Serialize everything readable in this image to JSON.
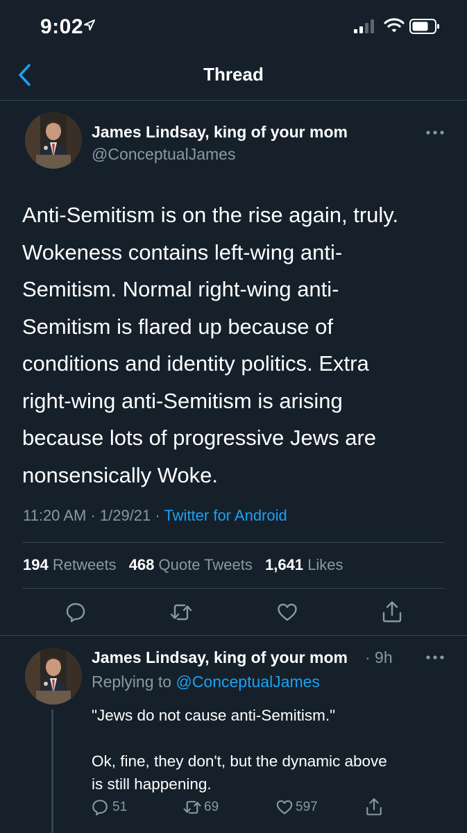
{
  "status_bar": {
    "time": "9:02"
  },
  "nav": {
    "title": "Thread"
  },
  "main_tweet": {
    "author_name": "James Lindsay, king of your mom",
    "author_handle": "@ConceptualJames",
    "text": "Anti-Semitism is on the rise again, truly.\nWokeness contains left-wing anti-\nSemitism. Normal right-wing anti-\nSemitism is flared up because of\nconditions and identity politics. Extra\nright-wing anti-Semitism is arising\nbecause lots of progressive Jews are\nnonsensically Woke.",
    "timestamp": "11:20 AM · 1/29/21 · ",
    "source": "Twitter for Android",
    "stats": {
      "retweets_count": "194",
      "retweets_label": "Retweets",
      "quotes_count": "468",
      "quotes_label": "Quote Tweets",
      "likes_count": "1,641",
      "likes_label": "Likes"
    }
  },
  "reply_tweet": {
    "author_name": "James Lindsay, king of your mom",
    "time": "· 9h",
    "replying_prefix": "Replying to ",
    "replying_to": "@ConceptualJames",
    "text": "\"Jews do not cause anti-Semitism.\"\n\nOk, fine, they don't, but the dynamic above\nis still happening.",
    "reply_count": "51",
    "retweet_count": "69",
    "like_count": "597"
  },
  "icons": {
    "back": "chevron-left-icon",
    "more": "more-horizontal-icon",
    "reply": "speech-bubble-icon",
    "retweet": "retweet-arrows-icon",
    "like": "heart-icon",
    "share": "share-up-arrow-icon"
  },
  "colors": {
    "background": "#15202b",
    "accent": "#1da1f2",
    "secondary_text": "#8899a6",
    "divider": "#38444d"
  }
}
